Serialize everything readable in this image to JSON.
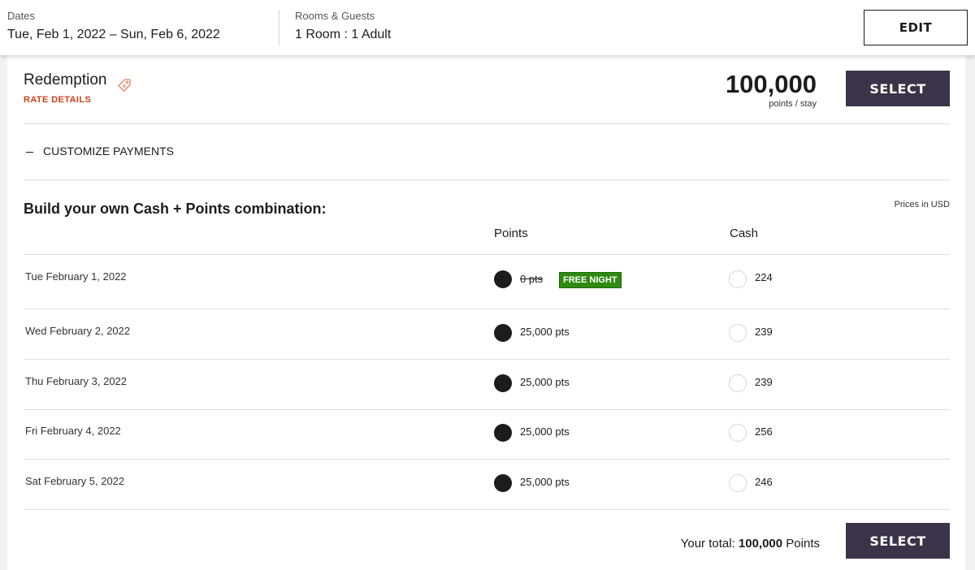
{
  "search": {
    "dates_label": "Dates",
    "dates_value": "Tue, Feb 1, 2022 – Sun, Feb 6, 2022",
    "rooms_label": "Rooms & Guests",
    "rooms_value": "1 Room : 1 Adult",
    "edit_label": "EDIT"
  },
  "rate": {
    "title": "Redemption",
    "details_link": "RATE DETAILS",
    "points": "100,000",
    "points_unit": "points / stay",
    "select_label": "SELECT"
  },
  "customize": {
    "label": "CUSTOMIZE PAYMENTS",
    "build_title": "Build your own Cash + Points combination:",
    "prices_note": "Prices in USD",
    "col_points": "Points",
    "col_cash": "Cash",
    "rows": [
      {
        "date": "Tue February 1, 2022",
        "points": "0 pts",
        "badge": "FREE NIGHT",
        "cash": "224",
        "selected": "points"
      },
      {
        "date": "Wed February 2, 2022",
        "points": "25,000 pts",
        "cash": "239",
        "selected": "points"
      },
      {
        "date": "Thu February 3, 2022",
        "points": "25,000 pts",
        "cash": "239",
        "selected": "points"
      },
      {
        "date": "Fri February 4, 2022",
        "points": "25,000 pts",
        "cash": "256",
        "selected": "points"
      },
      {
        "date": "Sat February 5, 2022",
        "points": "25,000 pts",
        "cash": "246",
        "selected": "points"
      }
    ],
    "total_prefix": "Your total:",
    "total_value": "100,000",
    "total_suffix": "Points",
    "select_label": "SELECT"
  },
  "icons": {
    "tag": "tag-icon",
    "collapse": "minus-icon"
  },
  "colors": {
    "accent_orange": "#c8421b",
    "button_dark": "#3b3347",
    "badge_green": "#2e8a10"
  }
}
